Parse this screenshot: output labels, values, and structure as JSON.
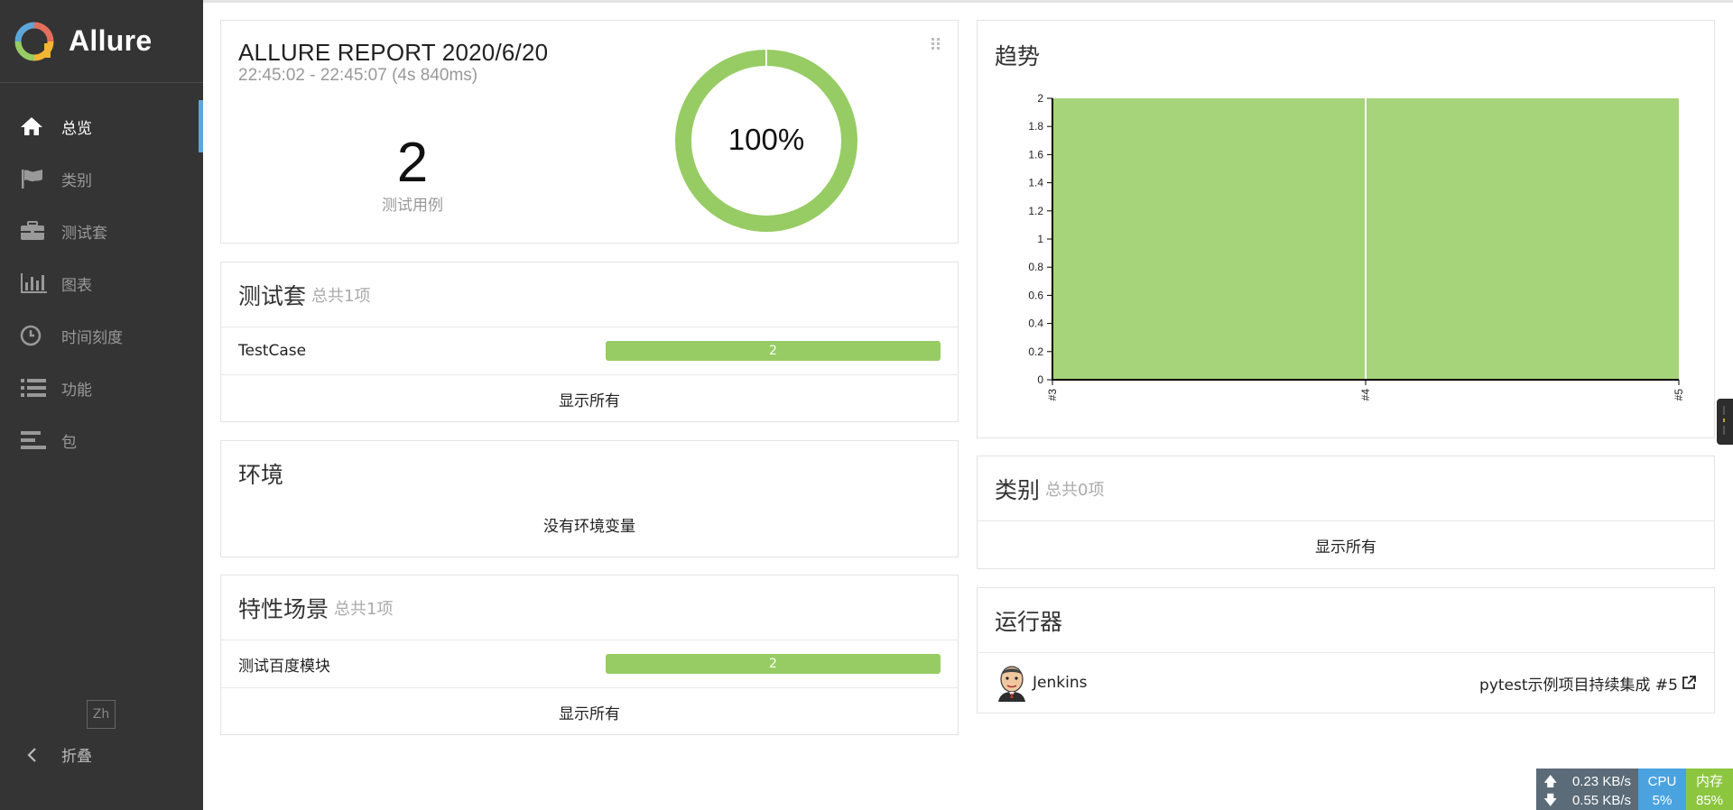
{
  "sidebar": {
    "brand": "Allure",
    "items": [
      {
        "label": "总览",
        "icon": "home-icon",
        "active": true
      },
      {
        "label": "类别",
        "icon": "flag-icon"
      },
      {
        "label": "测试套",
        "icon": "briefcase-icon"
      },
      {
        "label": "图表",
        "icon": "bar-chart-icon"
      },
      {
        "label": "时间刻度",
        "icon": "clock-icon"
      },
      {
        "label": "功能",
        "icon": "list-icon"
      },
      {
        "label": "包",
        "icon": "align-left-icon"
      }
    ],
    "language": "Zh",
    "collapse_label": "折叠"
  },
  "summary": {
    "title": "ALLURE REPORT 2020/6/20",
    "time_range": "22:45:02 - 22:45:07 (4s 840ms)",
    "test_count": "2",
    "test_count_label": "测试用例",
    "pass_rate_label": "100%",
    "pass_rate": 1.0,
    "donut_color": "#97cc64"
  },
  "suites": {
    "title": "测试套",
    "subtitle": "总共1项",
    "rows": [
      {
        "name": "TestCase",
        "count": "2"
      }
    ],
    "show_all": "显示所有"
  },
  "environment": {
    "title": "环境",
    "empty_text": "没有环境变量"
  },
  "features": {
    "title": "特性场景",
    "subtitle": "总共1项",
    "rows": [
      {
        "name": "测试百度模块",
        "count": "2"
      }
    ],
    "show_all": "显示所有"
  },
  "trend": {
    "title": "趋势"
  },
  "categories": {
    "title": "类别",
    "subtitle": "总共0项",
    "show_all": "显示所有"
  },
  "executors": {
    "title": "运行器",
    "name": "Jenkins",
    "build": "pytest示例项目持续集成 #5"
  },
  "status_bar": {
    "upload": "0.23 KB/s",
    "download": "0.55 KB/s",
    "cpu_label": "CPU",
    "cpu_value": "5%",
    "mem_label": "内存",
    "mem_value": "85%"
  },
  "colors": {
    "passed": "#97cc64",
    "sidebar_bg": "#343434",
    "accent": "#5ea6d8"
  },
  "chart_data": {
    "type": "area",
    "title": "",
    "xlabel": "",
    "ylabel": "",
    "categories": [
      "#3",
      "#4",
      "#5"
    ],
    "series": [
      {
        "values": [
          2,
          2,
          2
        ],
        "color": "#a6d47a"
      }
    ],
    "ylim": [
      0,
      2
    ],
    "yticks": [
      "0",
      "0.2",
      "0.4",
      "0.6",
      "0.8",
      "1",
      "1.2",
      "1.4",
      "1.6",
      "1.8",
      "2"
    ],
    "grid": false,
    "legend": "none"
  }
}
